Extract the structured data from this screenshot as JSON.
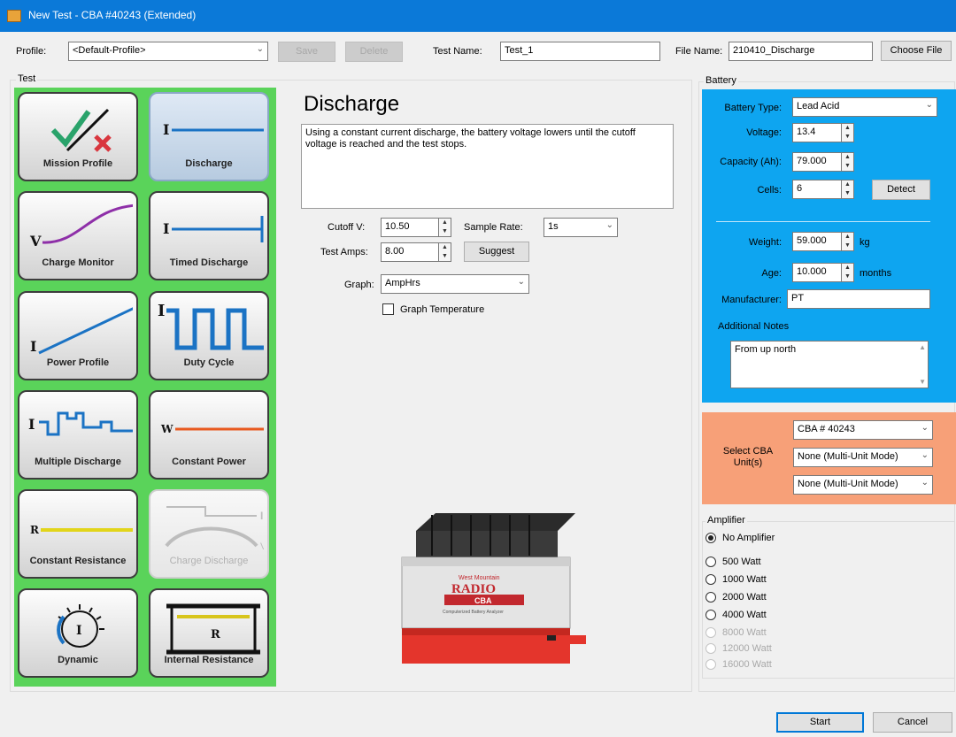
{
  "window": {
    "title": "New Test - CBA #40243 (Extended)"
  },
  "toolbar": {
    "profile_label": "Profile:",
    "profile_value": "<Default-Profile>",
    "save_label": "Save",
    "delete_label": "Delete",
    "test_name_label": "Test Name:",
    "test_name_value": "Test_1",
    "file_name_label": "File Name:",
    "file_name_value": "210410_Discharge",
    "choose_file_label": "Choose File"
  },
  "test": {
    "group_label": "Test",
    "buttons": [
      {
        "label": "Mission Profile",
        "icon": "mission-profile-icon"
      },
      {
        "label": "Discharge",
        "icon": "discharge-icon",
        "selected": true
      },
      {
        "label": "Charge Monitor",
        "icon": "charge-monitor-icon"
      },
      {
        "label": "Timed Discharge",
        "icon": "timed-discharge-icon"
      },
      {
        "label": "Power Profile",
        "icon": "power-profile-icon"
      },
      {
        "label": "Duty Cycle",
        "icon": "duty-cycle-icon"
      },
      {
        "label": "Multiple Discharge",
        "icon": "multiple-discharge-icon"
      },
      {
        "label": "Constant Power",
        "icon": "constant-power-icon"
      },
      {
        "label": "Constant Resistance",
        "icon": "constant-resistance-icon"
      },
      {
        "label": "Charge Discharge",
        "icon": "charge-discharge-icon",
        "disabled": true
      },
      {
        "label": "Dynamic",
        "icon": "dynamic-icon"
      },
      {
        "label": "Internal Resistance",
        "icon": "internal-resistance-icon"
      }
    ]
  },
  "center": {
    "heading": "Discharge",
    "description": "Using a constant current discharge, the battery voltage lowers until the cutoff voltage is reached and the test stops.",
    "cutoff_label": "Cutoff V:",
    "cutoff_value": "10.50",
    "sample_rate_label": "Sample Rate:",
    "sample_rate_value": "1s",
    "test_amps_label": "Test Amps:",
    "test_amps_value": "8.00",
    "suggest_label": "Suggest",
    "graph_label": "Graph:",
    "graph_value": "AmpHrs",
    "graph_temp_label": "Graph Temperature",
    "product": {
      "brand": "RADIO",
      "brand_top": "West Mountain",
      "model": "CBA",
      "subtitle": "Computerized Battery Analyzer"
    }
  },
  "battery": {
    "group_label": "Battery",
    "type_label": "Battery Type:",
    "type_value": "Lead Acid",
    "voltage_label": "Voltage:",
    "voltage_value": "13.4",
    "capacity_label": "Capacity (Ah):",
    "capacity_value": "79.000",
    "cells_label": "Cells:",
    "cells_value": "6",
    "detect_label": "Detect",
    "weight_label": "Weight:",
    "weight_value": "59.000",
    "weight_unit": "kg",
    "age_label": "Age:",
    "age_value": "10.000",
    "age_unit": "months",
    "manufacturer_label": "Manufacturer:",
    "manufacturer_value": "PT",
    "notes_label": "Additional Notes",
    "notes_value": "From up north",
    "colors": {
      "panel": "#0ea5f0",
      "select_panel": "#f7a078"
    }
  },
  "select_units": {
    "label": "Select CBA Unit(s)",
    "unit1": "CBA # 40243",
    "unit2": "None (Multi-Unit Mode)",
    "unit3": "None (Multi-Unit Mode)"
  },
  "amplifier": {
    "group_label": "Amplifier",
    "options": [
      {
        "label": "No Amplifier",
        "checked": true
      },
      {
        "label": "500 Watt"
      },
      {
        "label": "1000 Watt"
      },
      {
        "label": "2000 Watt"
      },
      {
        "label": "4000 Watt"
      },
      {
        "label": "8000 Watt",
        "disabled": true
      },
      {
        "label": "12000 Watt",
        "disabled": true
      },
      {
        "label": "16000 Watt",
        "disabled": true
      }
    ]
  },
  "footer": {
    "start_label": "Start",
    "cancel_label": "Cancel"
  }
}
